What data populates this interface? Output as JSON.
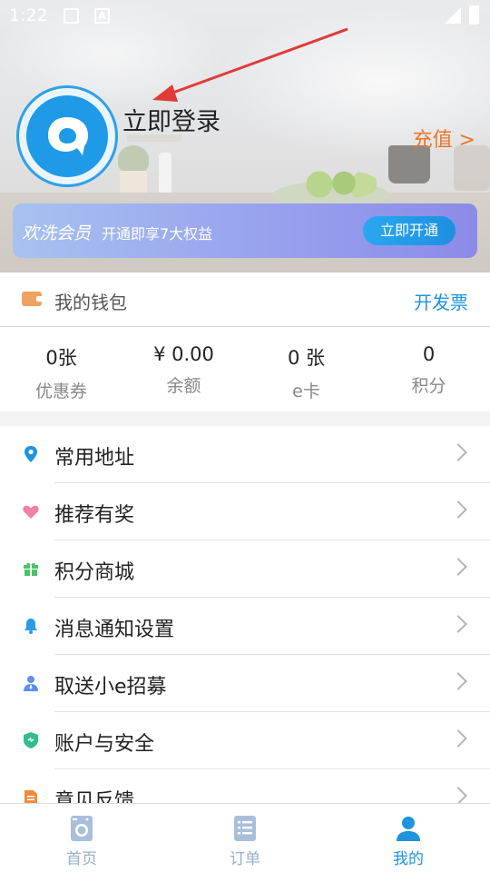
{
  "status_bar": {
    "time": "1:22"
  },
  "profile": {
    "login_label": "立即登录",
    "recharge_label": "充值 >"
  },
  "member_banner": {
    "title": "欢洗会员",
    "desc": "开通即享7大权益",
    "button": "立即开通"
  },
  "wallet": {
    "title": "我的钱包",
    "invoice_link": "开发票",
    "stats": [
      {
        "value": "0张",
        "label": "优惠券"
      },
      {
        "value": "¥ 0.00",
        "label": "余额"
      },
      {
        "value": "0 张",
        "label": "e卡"
      },
      {
        "value": "0",
        "label": "积分"
      }
    ]
  },
  "menu": {
    "items": [
      {
        "label": "常用地址",
        "icon": "location-pin-icon",
        "color": "#1f93dd"
      },
      {
        "label": "推荐有奖",
        "icon": "heart-icon",
        "color": "#f27fa4"
      },
      {
        "label": "积分商城",
        "icon": "gift-icon",
        "color": "#47c46a"
      },
      {
        "label": "消息通知设置",
        "icon": "bell-icon",
        "color": "#2b9be8"
      },
      {
        "label": "取送小e招募",
        "icon": "courier-icon",
        "color": "#5b8ff0"
      },
      {
        "label": "账户与安全",
        "icon": "shield-icon",
        "color": "#2fbf8f"
      },
      {
        "label": "意见反馈",
        "icon": "feedback-icon",
        "color": "#f28a3c"
      }
    ]
  },
  "tabbar": {
    "tabs": [
      {
        "label": "首页",
        "icon": "washing-machine-icon",
        "active": false
      },
      {
        "label": "订单",
        "icon": "order-list-icon",
        "active": false
      },
      {
        "label": "我的",
        "icon": "user-icon",
        "active": true
      }
    ]
  },
  "colors": {
    "accent_blue": "#1f93dd",
    "recharge_orange": "#f07426",
    "annotation_red": "#e03a3a"
  }
}
